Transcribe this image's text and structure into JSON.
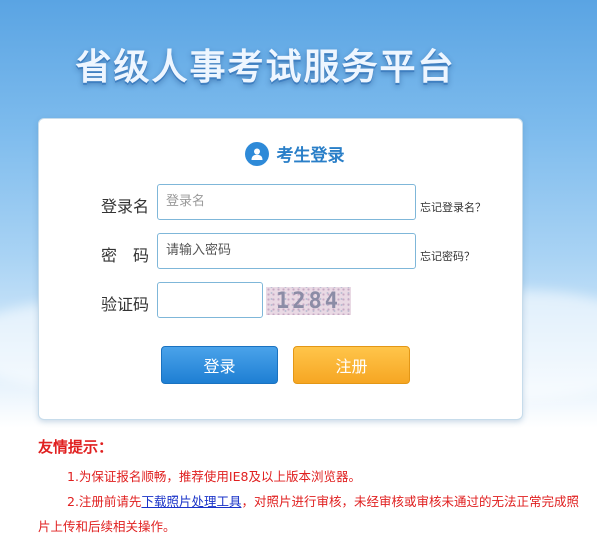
{
  "header": {
    "title": "省级人事考试服务平台"
  },
  "login": {
    "title": "考生登录",
    "username_label": "登录名",
    "username_value": "登录名",
    "password_label": "密　码",
    "password_value": "请输入密码",
    "captcha_label": "验证码",
    "captcha_value": "",
    "captcha_text": "1284",
    "forgot_username": "忘记登录名？",
    "forgot_password": "忘记密码？",
    "login_button": "登录",
    "register_button": "注册"
  },
  "tips": {
    "title": "友情提示：",
    "tip1": "1.为保证报名顺畅，推荐使用IE8及以上版本浏览器。",
    "tip2_prefix": "2.注册前请先",
    "tip2_link": "下载照片处理工具",
    "tip2_suffix": "，对照片进行审核，未经审核或审核未通过的无法正常完成照片上传和后续相关操作。"
  },
  "colors": {
    "accent_blue": "#2a7fc8",
    "login_button": "#1e7fd3",
    "register_button": "#f6a623",
    "tip_red": "#e02020",
    "link_blue": "#1a33c8"
  },
  "icons": {
    "login_header_icon": "user-icon"
  }
}
